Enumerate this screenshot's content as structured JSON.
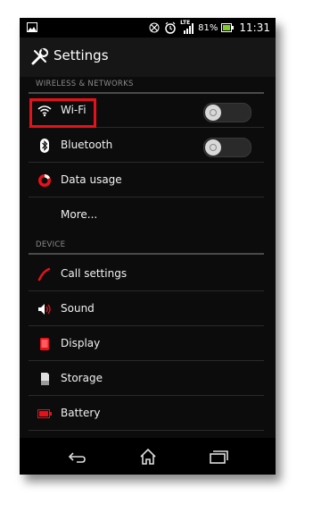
{
  "status_bar": {
    "network_type": "LTE",
    "battery_percent": "81%",
    "time": "11:31",
    "left_icon": "image-icon",
    "icons": [
      "rotate-icon",
      "alarm-icon",
      "signal-icon",
      "battery-icon"
    ]
  },
  "action_bar": {
    "title": "Settings",
    "icon": "wrench-icon"
  },
  "sections": [
    {
      "header": "WIRELESS & NETWORKS",
      "items": [
        {
          "label": "Wi-Fi",
          "icon": "wifi-icon",
          "toggle": true,
          "toggle_on": false
        },
        {
          "label": "Bluetooth",
          "icon": "bluetooth-icon",
          "toggle": true,
          "toggle_on": false
        },
        {
          "label": "Data usage",
          "icon": "data-usage-icon"
        },
        {
          "label": "More..."
        }
      ]
    },
    {
      "header": "DEVICE",
      "items": [
        {
          "label": "Call settings",
          "icon": "phone-icon"
        },
        {
          "label": "Sound",
          "icon": "speaker-icon"
        },
        {
          "label": "Display",
          "icon": "display-icon"
        },
        {
          "label": "Storage",
          "icon": "storage-icon"
        },
        {
          "label": "Battery",
          "icon": "battery-icon"
        }
      ]
    }
  ],
  "nav_bar": {
    "buttons": [
      "back-icon",
      "home-icon",
      "recent-apps-icon"
    ]
  },
  "colors": {
    "accent": "#e8111a",
    "background": "#0c0c0c",
    "text": "#f2f2f2",
    "section_header": "#8a8a8a"
  }
}
